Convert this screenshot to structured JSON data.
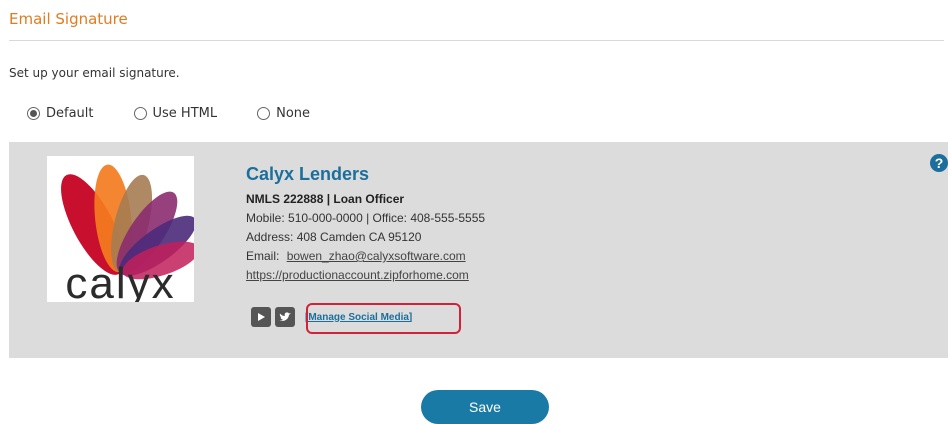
{
  "section": {
    "title": "Email Signature"
  },
  "intro": "Set up your email signature.",
  "options": [
    {
      "label": "Default",
      "checked": true
    },
    {
      "label": "Use HTML",
      "checked": false
    },
    {
      "label": "None",
      "checked": false
    }
  ],
  "logo": {
    "word": "calyx"
  },
  "signature": {
    "company": "Calyx Lenders",
    "title_line": "NMLS 222888 | Loan Officer",
    "phones": "Mobile: 510-000-0000 | Office: 408-555-5555",
    "address": "Address: 408 Camden CA 95120",
    "email_label": "Email:",
    "email": "bowen_zhao@calyxsoftware.com",
    "website": "https://productionaccount.zipforhome.com",
    "manage_social": "[Manage Social Media]"
  },
  "help_icon": "?",
  "save_label": "Save",
  "colors": {
    "accent_orange": "#e07b20",
    "brand_blue": "#1c6f9c",
    "save_button": "#1a7aa6",
    "highlight": "#d0233a",
    "panel_bg": "#dcdcdc"
  }
}
